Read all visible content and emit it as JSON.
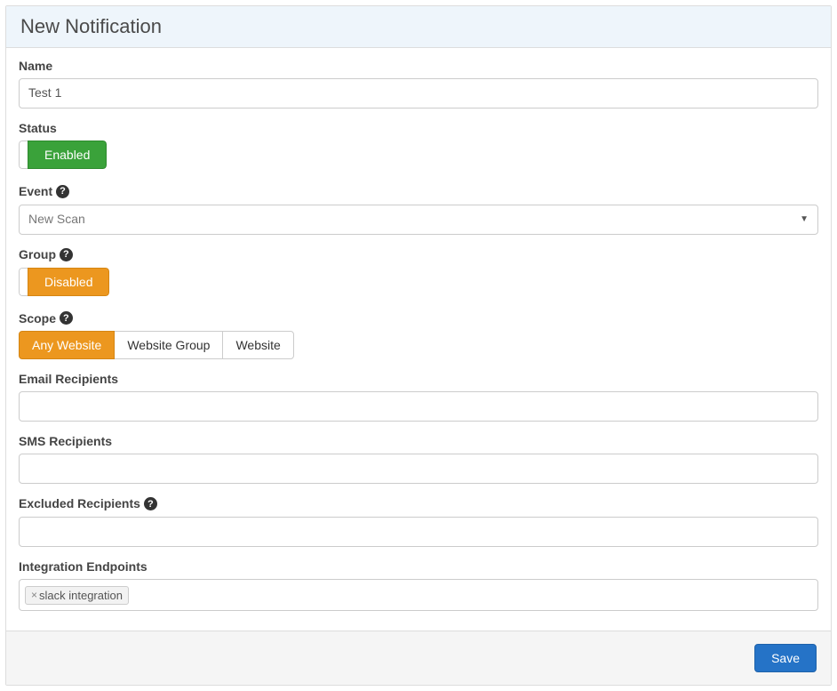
{
  "panel": {
    "title": "New Notification"
  },
  "form": {
    "name": {
      "label": "Name",
      "value": "Test 1"
    },
    "status": {
      "label": "Status",
      "value": "Enabled"
    },
    "event": {
      "label": "Event",
      "help": "?",
      "selected": "New Scan"
    },
    "group": {
      "label": "Group",
      "help": "?",
      "value": "Disabled"
    },
    "scope": {
      "label": "Scope",
      "help": "?",
      "options": [
        "Any Website",
        "Website Group",
        "Website"
      ],
      "selected_index": 0
    },
    "email_recipients": {
      "label": "Email Recipients",
      "value": ""
    },
    "sms_recipients": {
      "label": "SMS Recipients",
      "value": ""
    },
    "excluded_recipients": {
      "label": "Excluded Recipients",
      "help": "?",
      "value": ""
    },
    "integration_endpoints": {
      "label": "Integration Endpoints",
      "tags": [
        "slack integration"
      ]
    }
  },
  "footer": {
    "save_label": "Save"
  }
}
